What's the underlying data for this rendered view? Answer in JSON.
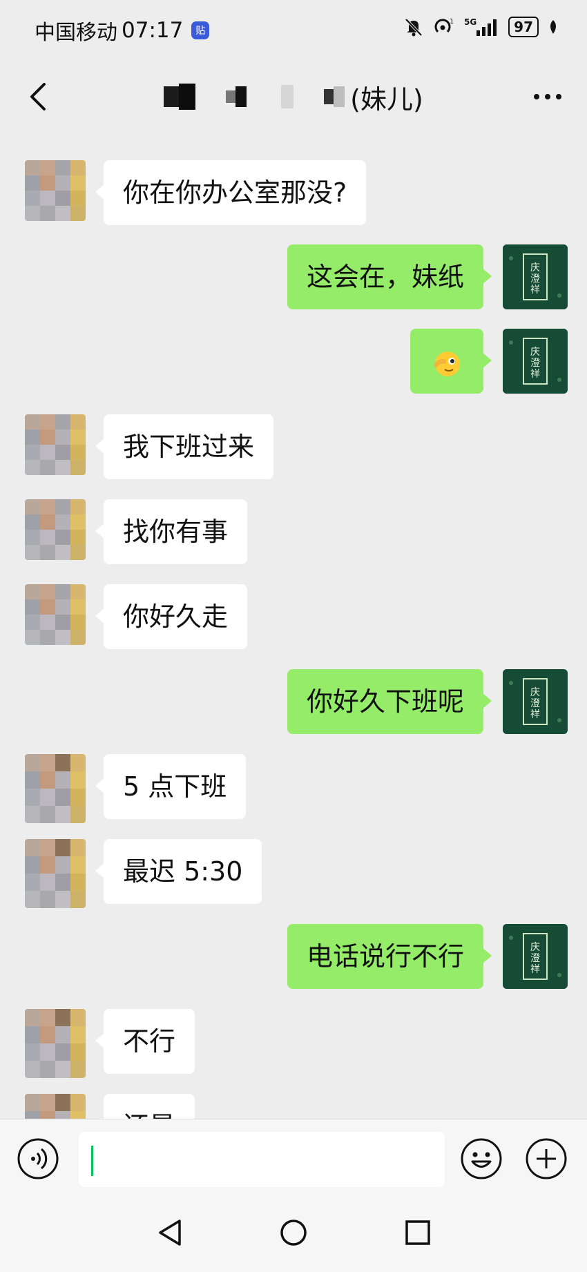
{
  "status_bar": {
    "carrier": "中国移动",
    "time": "07:17",
    "app_badge": "贴",
    "network": "5G",
    "battery": "97"
  },
  "header": {
    "title_suffix": "(妹儿)",
    "back_icon": "chevron-left-icon",
    "more_icon": "more-dots-icon",
    "more_label": "···"
  },
  "messages": [
    {
      "side": "in",
      "text": "你在你办公室那没?"
    },
    {
      "side": "out",
      "text": "这会在，妹纸"
    },
    {
      "side": "out",
      "text": "",
      "emoji": "peek-face-emoji"
    },
    {
      "side": "in",
      "text": "我下班过来"
    },
    {
      "side": "in",
      "text": "找你有事"
    },
    {
      "side": "in",
      "text": "你好久走"
    },
    {
      "side": "out",
      "text": "你好久下班呢"
    },
    {
      "side": "in",
      "text": "5 点下班"
    },
    {
      "side": "in",
      "text": "最迟 5:30"
    },
    {
      "side": "out",
      "text": "电话说行不行"
    },
    {
      "side": "in",
      "text": "不行"
    },
    {
      "side": "in",
      "text": "还是"
    }
  ],
  "input_bar": {
    "voice_icon": "voice-icon",
    "emoji_icon": "emoji-icon",
    "plus_icon": "plus-icon",
    "value": ""
  },
  "nav_bar": {
    "back_icon": "nav-back-icon",
    "home_icon": "nav-home-icon",
    "recent_icon": "nav-recent-icon"
  },
  "colors": {
    "background": "#ededed",
    "out_bubble": "#95ec69",
    "in_bubble": "#ffffff",
    "accent": "#07c160"
  }
}
